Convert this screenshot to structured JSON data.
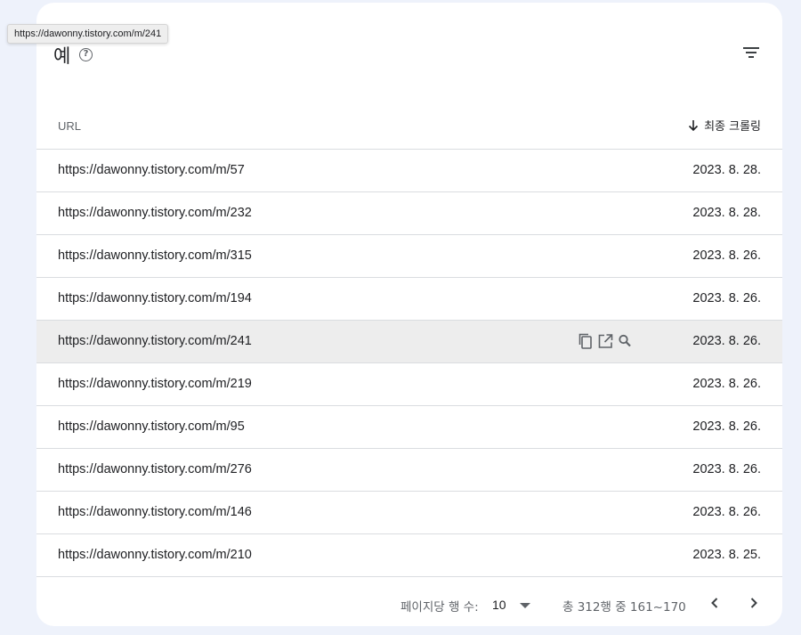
{
  "tooltip": "https://dawonny.tistory.com/m/241",
  "card": {
    "title": "예",
    "help_icon": "help-circle-icon",
    "filter_icon": "filter-icon"
  },
  "table": {
    "columns": {
      "url": "URL",
      "date": "최종 크롤링",
      "sort_icon": "arrow-down-icon"
    },
    "rows": [
      {
        "url": "https://dawonny.tistory.com/m/57",
        "date": "2023. 8. 28."
      },
      {
        "url": "https://dawonny.tistory.com/m/232",
        "date": "2023. 8. 28."
      },
      {
        "url": "https://dawonny.tistory.com/m/315",
        "date": "2023. 8. 26."
      },
      {
        "url": "https://dawonny.tistory.com/m/194",
        "date": "2023. 8. 26."
      },
      {
        "url": "https://dawonny.tistory.com/m/241",
        "date": "2023. 8. 26."
      },
      {
        "url": "https://dawonny.tistory.com/m/219",
        "date": "2023. 8. 26."
      },
      {
        "url": "https://dawonny.tistory.com/m/95",
        "date": "2023. 8. 26."
      },
      {
        "url": "https://dawonny.tistory.com/m/276",
        "date": "2023. 8. 26."
      },
      {
        "url": "https://dawonny.tistory.com/m/146",
        "date": "2023. 8. 26."
      },
      {
        "url": "https://dawonny.tistory.com/m/210",
        "date": "2023. 8. 25."
      }
    ],
    "hovered_row": 4,
    "row_action_icons": [
      "copy-icon",
      "open-in-new-icon",
      "search-icon"
    ]
  },
  "pagination": {
    "rows_per_page_label": "페이지당 행 수:",
    "rows_per_page_value": "10",
    "range_text": "총 312행 중 161~170",
    "prev_icon": "chevron-left-icon",
    "next_icon": "chevron-right-icon"
  },
  "colors": {
    "page_background": "#eef2fb",
    "card_background": "#ffffff",
    "hover_row": "#ededed",
    "divider": "#dadce0",
    "icon": "#5f6368"
  }
}
